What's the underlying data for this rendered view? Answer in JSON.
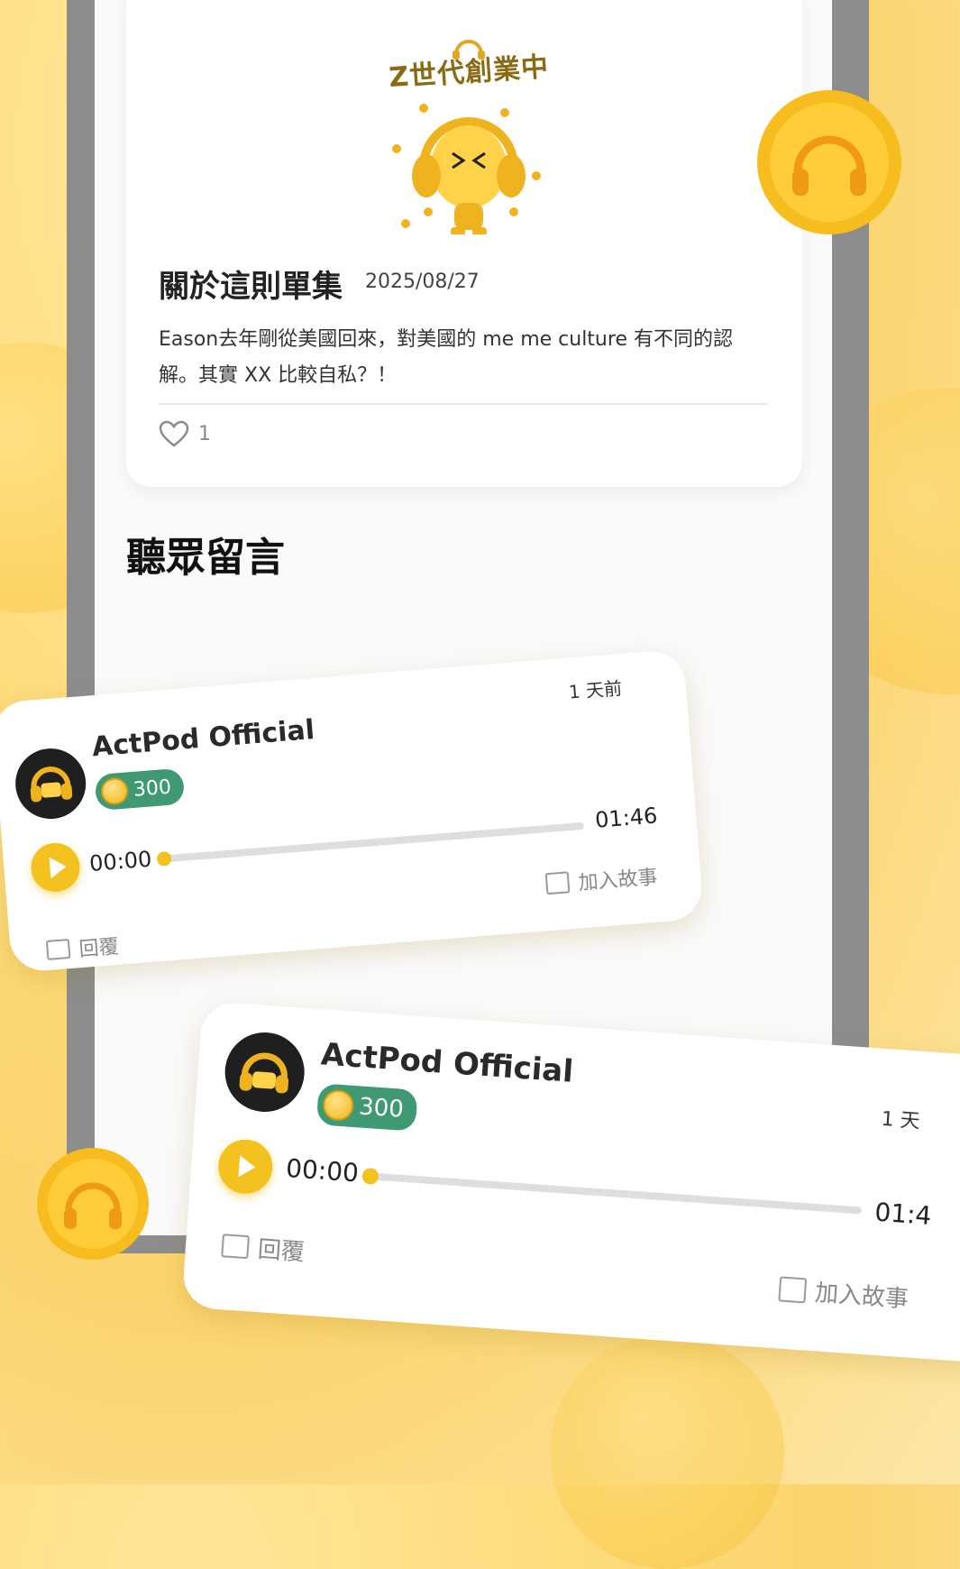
{
  "episode": {
    "logo_text": "Z世代創業中",
    "heading": "關於這則單集",
    "date": "2025/08/27",
    "description": "Eason去年剛從美國回來，對美國的 me me culture 有不同的認解。其實 XX 比較自私？！",
    "likes": "1"
  },
  "section_title": "聽眾留言",
  "comments": [
    {
      "user": "ActPod  Official",
      "coins": "300",
      "ago": "1 天前",
      "time_current": "00:00",
      "duration": "01:46",
      "reply_label": "回覆",
      "add_story_label": "加入故事"
    },
    {
      "user": "ActPod  Official",
      "coins": "300",
      "ago": "1 天",
      "time_current": "00:00",
      "duration": "01:4",
      "reply_label": "回覆",
      "add_story_label": "加入故事"
    }
  ],
  "colors": {
    "accent": "#f3c21f",
    "badge": "#3f9a73",
    "background": "#fbd46e"
  },
  "icons": [
    "headphones-coin-icon",
    "heart-icon",
    "play-icon",
    "reply-icon",
    "add-story-icon",
    "coin-icon"
  ]
}
